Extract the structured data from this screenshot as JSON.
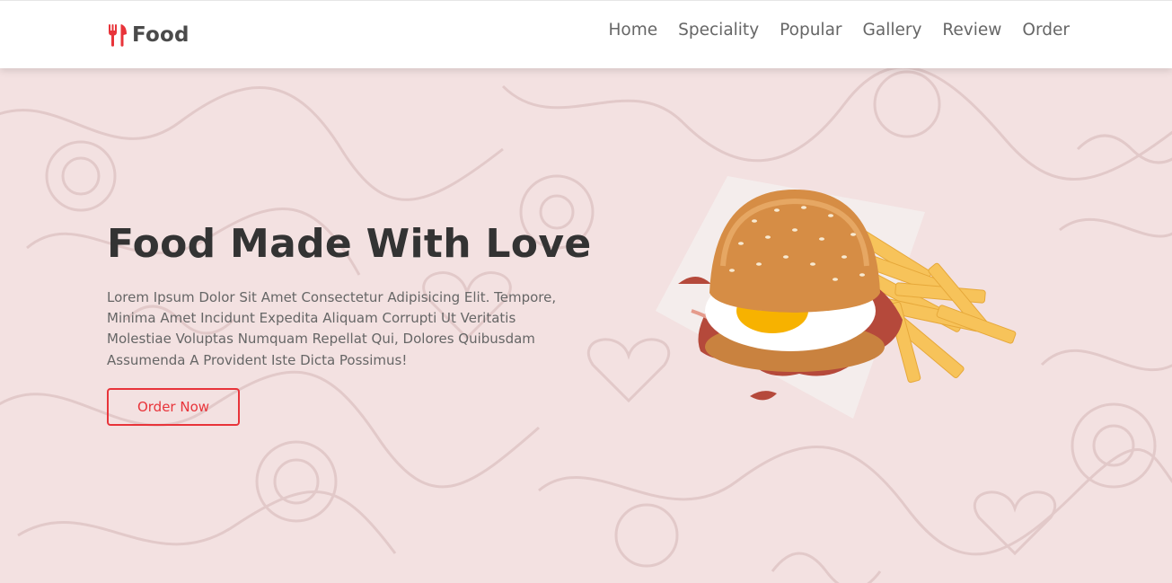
{
  "header": {
    "logo": {
      "icon": "utensils-icon",
      "text": "Food"
    },
    "nav": [
      "Home",
      "Speciality",
      "Popular",
      "Gallery",
      "Review",
      "Order"
    ]
  },
  "hero": {
    "title": "Food Made With Love",
    "description": "Lorem Ipsum Dolor Sit Amet Consectetur Adipisicing Elit. Tempore, Minima Amet Incidunt Expedita Aliquam Corrupti Ut Veritatis Molestiae Voluptas Numquam Repellat Qui, Dolores Quibusdam Assumenda A Provident Iste Dicta Possimus!",
    "button_label": "Order Now",
    "image": "burger-with-fries-image"
  },
  "colors": {
    "accent": "#e8343a",
    "hero_background": "#f3e1e1",
    "heading": "#333333",
    "body_text": "#666666"
  }
}
